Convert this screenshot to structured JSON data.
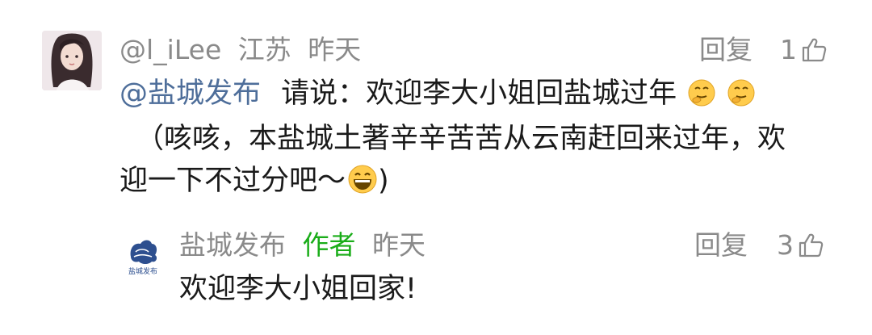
{
  "comment": {
    "user_name": "@l_iLee",
    "location": "江苏",
    "time": "昨天",
    "reply_label": "回复",
    "like_count": "1",
    "mention": "@盐城发布",
    "line1_text": "请说：欢迎李大小姐回盐城过年",
    "line2_text": "（咳咳，本盐城土著辛辛苦苦从云南赶回来过年，欢",
    "line3_text": "迎一下不过分吧～",
    "line3_end": ")"
  },
  "reply": {
    "user_name": "盐城发布",
    "author_badge": "作者",
    "time": "昨天",
    "reply_label": "回复",
    "like_count": "3",
    "logo_text": "盐城发布",
    "text": "欢迎李大小姐回家!"
  }
}
